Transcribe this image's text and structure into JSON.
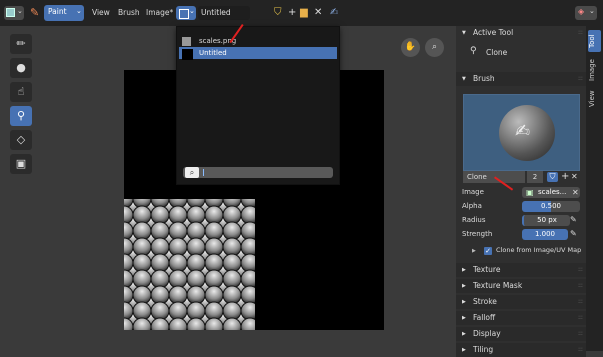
{
  "topbar": {
    "editor_type_icon": "image-editor-icon",
    "mode_label": "Paint",
    "menu": [
      "View",
      "Brush",
      "Image*"
    ],
    "image_name": "Untitled"
  },
  "dropdown": {
    "items": [
      {
        "label": "scales.png",
        "selected": false
      },
      {
        "label": "Untitled",
        "selected": true
      }
    ],
    "search_placeholder": ""
  },
  "panel": {
    "active_tool_header": "Active Tool",
    "active_tool_name": "Clone",
    "brush_header": "Brush",
    "brush_name": "Clone",
    "brush_users": "2",
    "image_label": "Image",
    "image_value": "scales...",
    "alpha_label": "Alpha",
    "alpha_value": "0.500",
    "radius_label": "Radius",
    "radius_value": "50 px",
    "strength_label": "Strength",
    "strength_value": "1.000",
    "clone_uv_label": "Clone from Image/UV Map",
    "sections": [
      "Texture",
      "Texture Mask",
      "Stroke",
      "Falloff",
      "Display",
      "Tiling"
    ]
  },
  "tabs": [
    "Tool",
    "Image",
    "View"
  ],
  "colors": {
    "accent": "#4772b3",
    "annotation": "#e02020"
  }
}
